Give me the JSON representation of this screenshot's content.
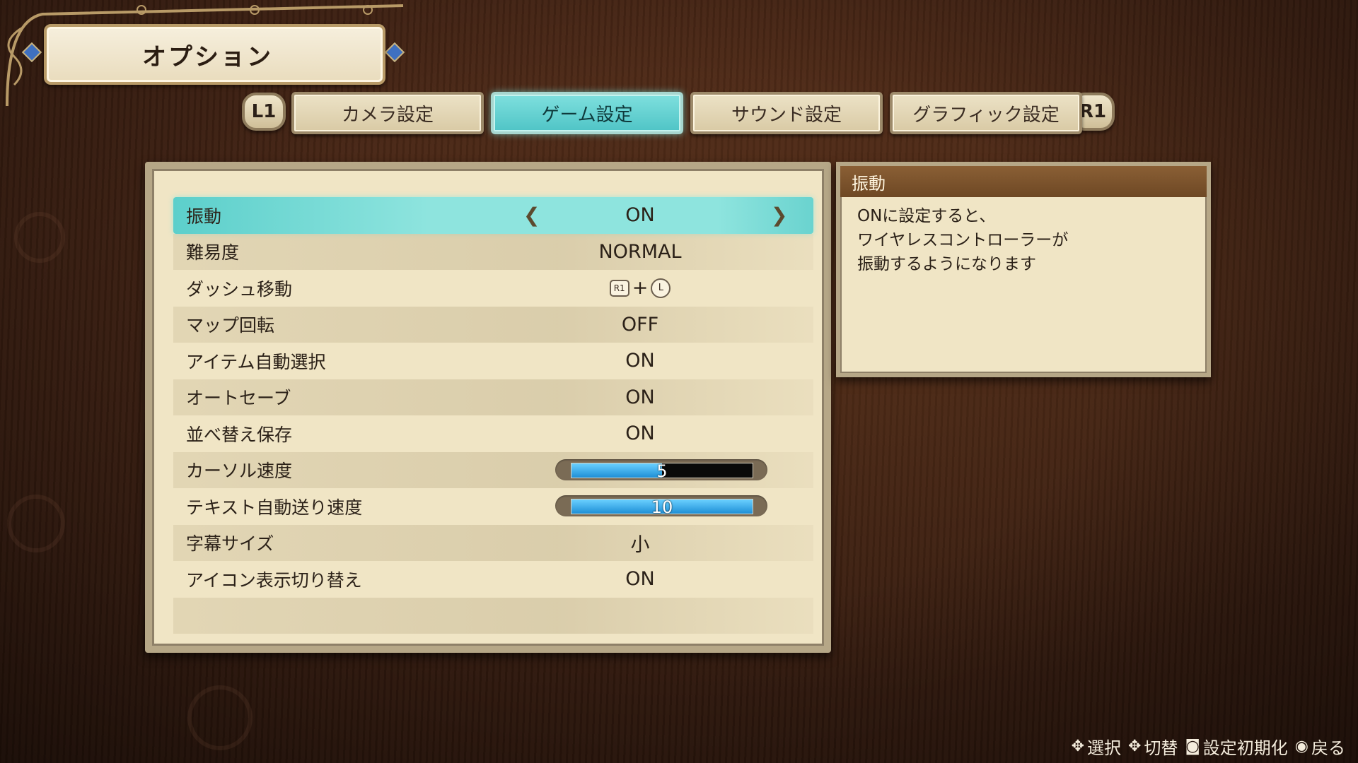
{
  "title": "オプション",
  "shoulders": {
    "left": "L1",
    "right": "R1"
  },
  "tabs": [
    {
      "label": "カメラ設定",
      "active": false
    },
    {
      "label": "ゲーム設定",
      "active": true
    },
    {
      "label": "サウンド設定",
      "active": false
    },
    {
      "label": "グラフィック設定",
      "active": false
    }
  ],
  "settings": [
    {
      "label": "振動",
      "value": "ON",
      "selected": true
    },
    {
      "label": "難易度",
      "value": "NORMAL"
    },
    {
      "label": "ダッシュ移動",
      "value": "+",
      "buttons": [
        "R1",
        "L"
      ]
    },
    {
      "label": "マップ回転",
      "value": "OFF"
    },
    {
      "label": "アイテム自動選択",
      "value": "ON"
    },
    {
      "label": "オートセーブ",
      "value": "ON"
    },
    {
      "label": "並べ替え保存",
      "value": "ON"
    },
    {
      "label": "カーソル速度",
      "value": "5",
      "slider_fraction": 0.5
    },
    {
      "label": "テキスト自動送り速度",
      "value": "10",
      "slider_fraction": 1.0
    },
    {
      "label": "字幕サイズ",
      "value": "小"
    },
    {
      "label": "アイコン表示切り替え",
      "value": "ON"
    }
  ],
  "description": {
    "title": "振動",
    "lines": [
      "ONに設定すると、",
      "ワイヤレスコントローラーが",
      "振動するようになります"
    ]
  },
  "hints": [
    {
      "icon": "dpad-icon",
      "label": "選択"
    },
    {
      "icon": "dpad-icon",
      "label": "切替"
    },
    {
      "icon": "square-button-icon",
      "label": "設定初期化"
    },
    {
      "icon": "circle-button-icon",
      "label": "戻る"
    }
  ],
  "colors": {
    "accent": "#5ccfcb",
    "panel": "#f0e5c5",
    "background": "#3d2012",
    "slider_fill": "#1e8fd6"
  }
}
